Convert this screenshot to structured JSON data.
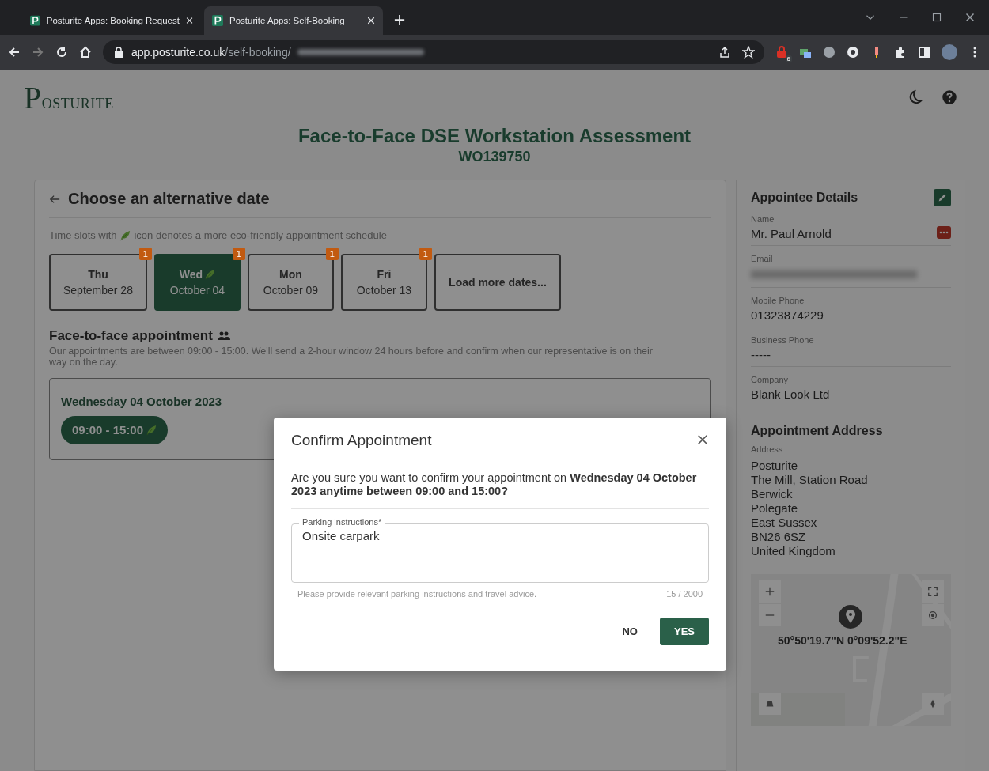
{
  "browser": {
    "tabs": [
      {
        "title": "Posturite Apps: Booking Request",
        "selected": false
      },
      {
        "title": "Posturite Apps: Self-Booking",
        "selected": true
      }
    ],
    "url": {
      "host": "app.posturite.co.uk",
      "path": "/self-booking/"
    },
    "extension_badge": "6"
  },
  "header": {
    "logo": "POSTURITE",
    "title": "Face-to-Face DSE Workstation Assessment",
    "reference": "WO139750"
  },
  "main": {
    "heading": "Choose an alternative date",
    "eco_note": {
      "before": "Time slots with",
      "after": "icon denotes a more eco-friendly appointment schedule"
    },
    "dates": [
      {
        "day": "Thu",
        "date": "September 28",
        "badge": "1",
        "selected": false,
        "eco": false
      },
      {
        "day": "Wed",
        "date": "October 04",
        "badge": "1",
        "selected": true,
        "eco": true
      },
      {
        "day": "Mon",
        "date": "October 09",
        "badge": "1",
        "selected": false,
        "eco": false
      },
      {
        "day": "Fri",
        "date": "October 13",
        "badge": "1",
        "selected": false,
        "eco": false
      }
    ],
    "load_more": "Load more dates...",
    "section": {
      "title": "Face-to-face appointment",
      "description": "Our appointments are between 09:00 - 15:00. We'll send a 2-hour window 24 hours before and confirm when our representative is on their way on the day."
    },
    "slot": {
      "date_heading": "Wednesday 04 October 2023",
      "time": "09:00 - 15:00",
      "eco": true
    }
  },
  "sidebar": {
    "heading": "Appointee Details",
    "fields": [
      {
        "label": "Name",
        "value": "Mr. Paul Arnold",
        "redacted": false
      },
      {
        "label": "Email",
        "redacted": true
      },
      {
        "label": "Mobile Phone",
        "value": "01323874229",
        "redacted": false
      },
      {
        "label": "Business Phone",
        "value": "-----",
        "redacted": false
      },
      {
        "label": "Company",
        "value": "Blank Look Ltd",
        "redacted": false
      }
    ],
    "address_heading": "Appointment Address",
    "address_label": "Address",
    "address_lines": [
      "Posturite",
      "The Mill, Station Road",
      "Berwick",
      "Polegate",
      "East Sussex",
      "BN26 6SZ",
      "United Kingdom"
    ],
    "map": {
      "coordinates": "50°50'19.7\"N 0°09'52.2\"E"
    }
  },
  "dialog": {
    "title": "Confirm Appointment",
    "message": "Are you sure you want to confirm your appointment on **Wednesday 04 October 2023 anytime between 09:00 and 15:00?**",
    "field": {
      "label": "Parking instructions*",
      "value": "Onsite carpark",
      "hint": "Please provide relevant parking instructions and travel advice.",
      "counter": "15 / 2000"
    },
    "buttons": [
      {
        "label": "NO",
        "kind": "text"
      },
      {
        "label": "YES",
        "kind": "primary"
      }
    ]
  }
}
